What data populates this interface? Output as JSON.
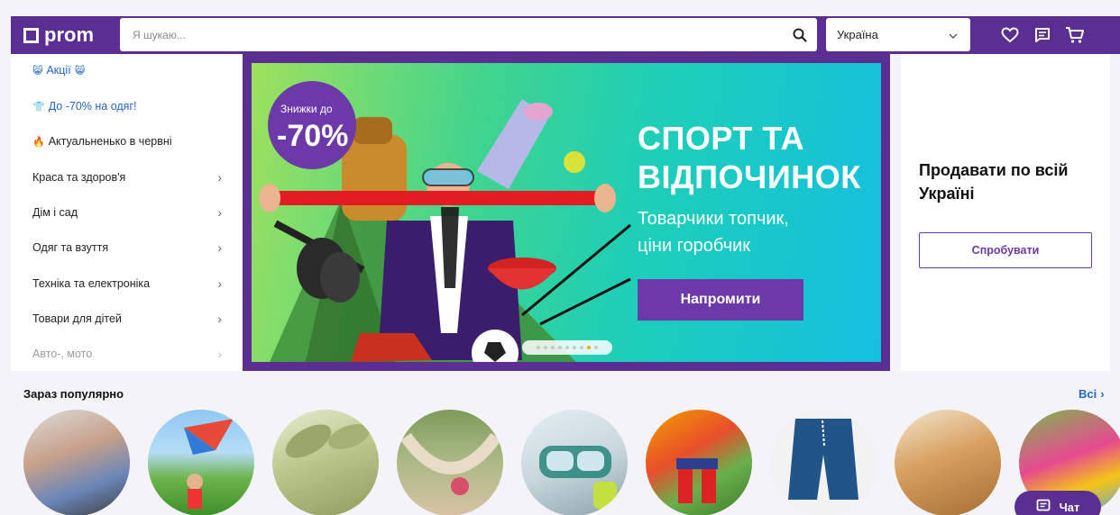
{
  "header": {
    "logo_text": "prom",
    "search_placeholder": "Я шукаю...",
    "region": "Україна",
    "icons": [
      "search-icon",
      "chevron-down-icon",
      "heart-icon",
      "message-icon",
      "cart-icon"
    ],
    "brand_color": "#5b2f91"
  },
  "sidebar": {
    "items": [
      {
        "label": "Акції",
        "emoji": "😸"
      },
      {
        "label": "До -70% на одяг!",
        "emoji": "👕"
      },
      {
        "label": "Актуальненько в червні",
        "emoji": "🔥"
      },
      {
        "label": "Краса та здоров'я"
      },
      {
        "label": "Дім і сад"
      },
      {
        "label": "Одяг та взуття"
      },
      {
        "label": "Техніка та електроніка"
      },
      {
        "label": "Товари для дітей"
      },
      {
        "label": "Авто-, мото"
      }
    ]
  },
  "banner": {
    "discount_small": "Знижки до",
    "discount_big": "-70%",
    "title_line1": "СПОРТ ТА",
    "title_line2": "ВІДПОЧИНОК",
    "subtitle_line1": "Товарчики топчик,",
    "subtitle_line2": "ціни горобчик",
    "button": "Напромити",
    "slides_total": 9,
    "active_slide": 8
  },
  "sell": {
    "title": "Продавати по всій Україні",
    "button": "Спробувати"
  },
  "popular": {
    "title": "Зараз популярно",
    "all_link": "Всі",
    "categories": [
      "shorts",
      "kite",
      "herbal-powder",
      "hammock",
      "snorkel-mask",
      "rain-boots",
      "men-shorts",
      "copper-mug",
      "inflatable-castle"
    ]
  },
  "chat": {
    "label": "Чат"
  }
}
